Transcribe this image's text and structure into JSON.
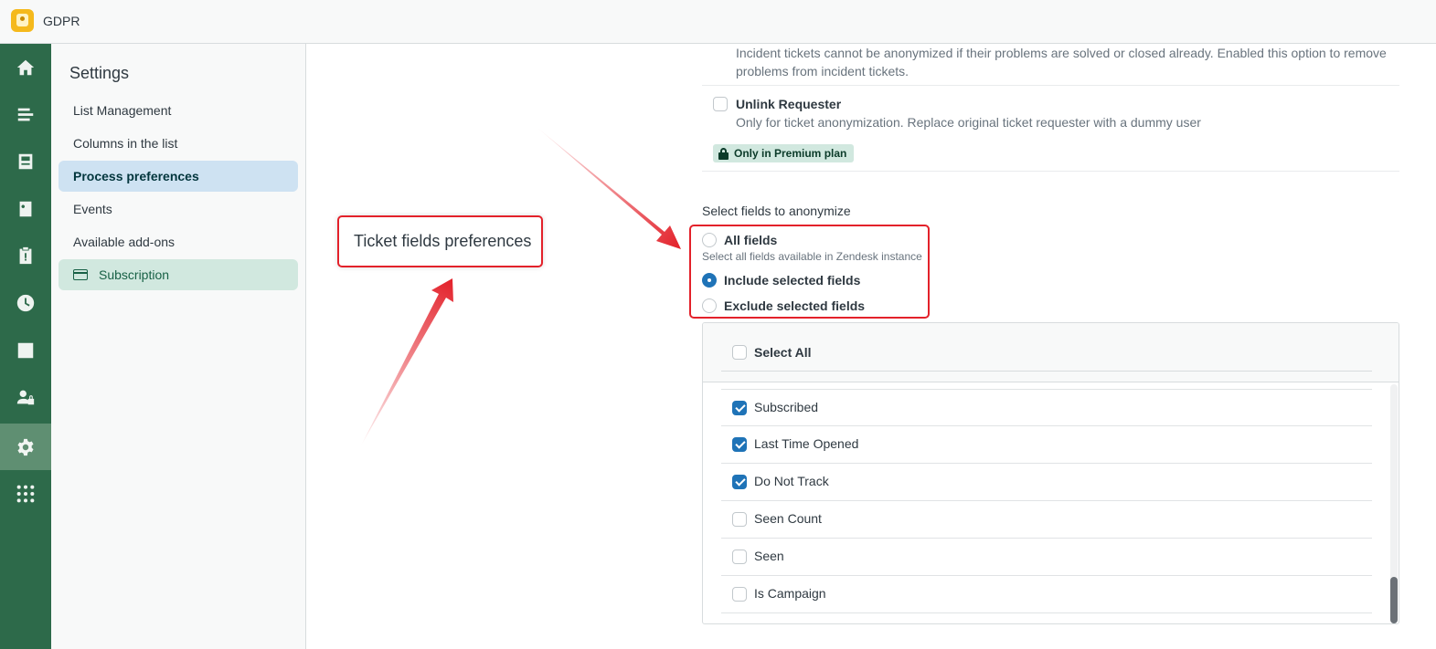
{
  "app": {
    "title": "GDPR"
  },
  "rail": {
    "items": [
      {
        "icon": "home-icon"
      },
      {
        "icon": "list-icon"
      },
      {
        "icon": "inbox-icon"
      },
      {
        "icon": "id-card-icon"
      },
      {
        "icon": "clipboard-icon"
      },
      {
        "icon": "clock-icon"
      },
      {
        "icon": "chart-icon"
      },
      {
        "icon": "user-lock-icon"
      },
      {
        "icon": "gear-icon",
        "active": true
      },
      {
        "icon": "apps-grid-icon"
      }
    ]
  },
  "sidebar": {
    "title": "Settings",
    "items": [
      {
        "label": "List Management"
      },
      {
        "label": "Columns in the list"
      },
      {
        "label": "Process preferences",
        "selected": true
      },
      {
        "label": "Events"
      },
      {
        "label": "Available add-ons"
      },
      {
        "label": "Subscription",
        "icon": "credit-card-icon"
      }
    ]
  },
  "main": {
    "incident_description": "Incident tickets cannot be anonymized if their problems are solved or closed already. Enabled this option to remove problems from incident tickets.",
    "unlink_requester": {
      "label": "Unlink Requester",
      "description": "Only for ticket anonymization. Replace original ticket requester with a dummy user",
      "badge": "Only in Premium plan",
      "checked": false
    },
    "fields_section": {
      "label": "Select fields to anonymize",
      "options": [
        {
          "label": "All fields",
          "hint": "Select all fields available in Zendesk instance",
          "selected": false
        },
        {
          "label": "Include selected fields",
          "selected": true
        },
        {
          "label": "Exclude selected fields",
          "selected": false
        }
      ]
    },
    "field_list": {
      "select_all_label": "Select All",
      "rows": [
        {
          "label": "Subscribed",
          "checked": true
        },
        {
          "label": "Last Time Opened",
          "checked": true
        },
        {
          "label": "Do Not Track",
          "checked": true
        },
        {
          "label": "Seen Count",
          "checked": false
        },
        {
          "label": "Seen",
          "checked": false
        },
        {
          "label": "Is Campaign",
          "checked": false
        }
      ]
    }
  },
  "annotation": {
    "callout_text": "Ticket fields preferences",
    "color": "#e3212a"
  },
  "colors": {
    "rail": "#2d6a4a",
    "accent": "#1f73b7",
    "selected_nav": "#cee2f2",
    "subscription_nav": "#d1e8df"
  }
}
